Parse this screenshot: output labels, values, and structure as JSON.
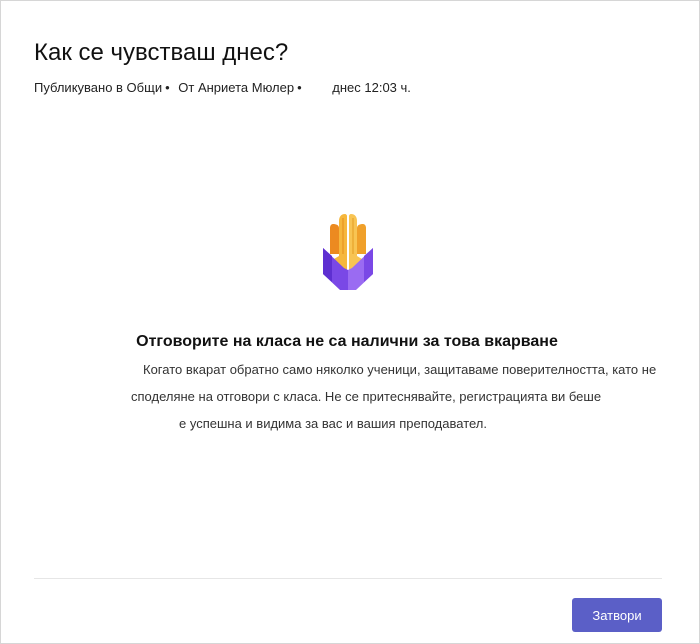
{
  "dialog": {
    "title": "Как се чувстваш днес?",
    "meta": {
      "posted_in": "Публикувано в Общи",
      "separator": "•",
      "author": "От Анриета Мюлер",
      "time": "днес 12:03 ч."
    },
    "icon": "praying-hands-icon",
    "heading": "Отговорите на класа не са налични за това вкарване",
    "body_lines": [
      "Когато вкарат обратно само няколко ученици, защитаваме поверителността, като не",
      "споделяне на отговори с класа. Не се притеснявайте, регистрацията ви беше",
      "е успешна и видима за вас и вашия преподавател."
    ],
    "close_label": "Затвори"
  },
  "colors": {
    "accent": "#5b5fc7",
    "icon_yellow": "#f6b73c",
    "icon_orange": "#ec8a20",
    "icon_purple": "#7a48e6"
  }
}
